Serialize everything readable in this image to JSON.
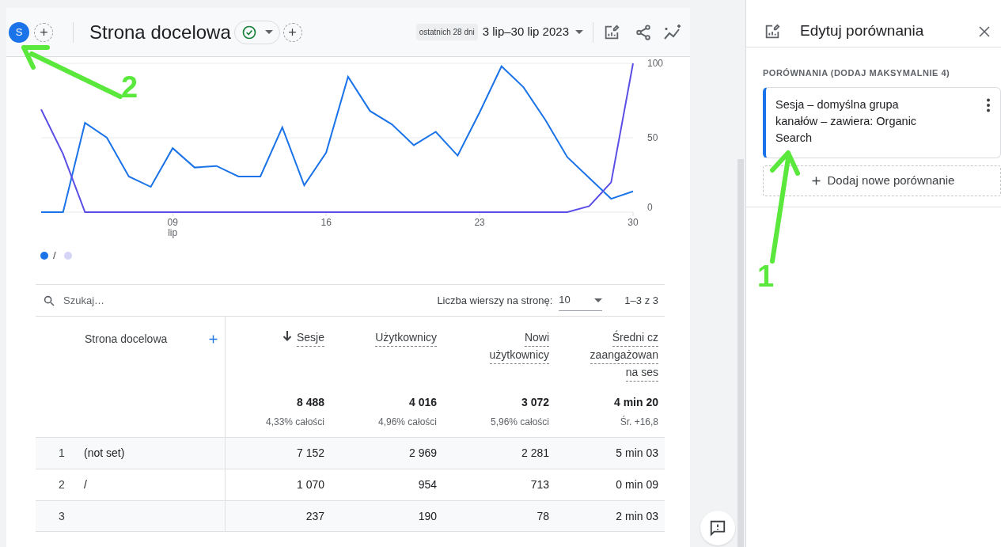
{
  "header": {
    "avatar": "S",
    "title": "Strona docelowa",
    "date_chip": "ostatnich 28 dni",
    "date_range": "3 lip–30 lip 2023"
  },
  "chart": {
    "chart_data": {
      "type": "line",
      "x": [
        3,
        4,
        5,
        6,
        7,
        8,
        9,
        10,
        11,
        12,
        13,
        14,
        15,
        16,
        17,
        18,
        19,
        20,
        21,
        22,
        23,
        24,
        25,
        26,
        27,
        28,
        29,
        30
      ],
      "xlim": [
        3,
        30
      ],
      "ylim": [
        0,
        100
      ],
      "yticks": [
        0,
        50,
        100
      ],
      "xticks": [
        {
          "value": 9,
          "label": "09 lip"
        },
        {
          "value": 16,
          "label": "16"
        },
        {
          "value": 23,
          "label": "23"
        },
        {
          "value": 30,
          "label": "30"
        }
      ],
      "series": [
        {
          "name": "/",
          "color": "#1a73e8",
          "values": [
            0,
            0,
            60,
            50,
            24,
            17,
            43,
            30,
            31,
            24,
            24,
            57,
            18,
            40,
            91,
            68,
            59,
            45,
            54,
            38,
            67,
            98,
            84,
            62,
            37,
            23,
            9,
            14
          ]
        },
        {
          "color": "#5b4ee6",
          "values": [
            69,
            39,
            0,
            0,
            0,
            0,
            0,
            0,
            0,
            0,
            0,
            0,
            0,
            0,
            0,
            0,
            0,
            0,
            0,
            0,
            0,
            0,
            0,
            0,
            0,
            4,
            20,
            100
          ]
        }
      ]
    },
    "legend": [
      {
        "color": "#1a73e8"
      },
      {
        "color": "#d6d4f7"
      }
    ]
  },
  "table": {
    "search": {
      "placeholder": "Szukaj…"
    },
    "rows_per_page_label": "Liczba wierszy na stronę:",
    "rows_per_page": "10",
    "pagination": "1–3 z 3",
    "columns": [
      {
        "lines": [
          "Strona docelowa"
        ],
        "sorted": false
      },
      {
        "lines": [
          "Sesje"
        ],
        "sorted": true
      },
      {
        "lines": [
          "Użytkownicy"
        ],
        "sorted": false
      },
      {
        "lines": [
          "Nowi",
          "użytkownicy"
        ],
        "sorted": false
      },
      {
        "lines": [
          "Średni cz",
          "zaangażowan",
          "na ses"
        ],
        "sorted": false
      }
    ],
    "totals": [
      {
        "value": "8 488",
        "note": "4,33% całości"
      },
      {
        "value": "4 016",
        "note": "4,96% całości"
      },
      {
        "value": "3 072",
        "note": "5,96% całości"
      },
      {
        "value": "4 min 20",
        "note": "Śr. +16,8"
      }
    ],
    "rows": [
      {
        "index": "1",
        "cells": [
          "(not set)",
          "7 152",
          "2 969",
          "2 281",
          "5 min 03"
        ]
      },
      {
        "index": "2",
        "cells": [
          "/",
          "1 070",
          "954",
          "713",
          "0 min 09"
        ]
      },
      {
        "index": "3",
        "cells": [
          "",
          "237",
          "190",
          "78",
          "2 min 03"
        ]
      }
    ]
  },
  "comparisons_panel": {
    "title": "Edytuj porównania",
    "section_label": "PORÓWNANIA (DODAJ MAKSYMALNIE 4)",
    "comparisons": [
      {
        "label": "Sesja – domyślna grupa kanałów – zawiera: Organic Search",
        "color": "#1a73e8"
      }
    ],
    "add_button": "Dodaj nowe porównanie"
  },
  "annotations": [
    {
      "label": "2"
    },
    {
      "label": "1"
    }
  ]
}
